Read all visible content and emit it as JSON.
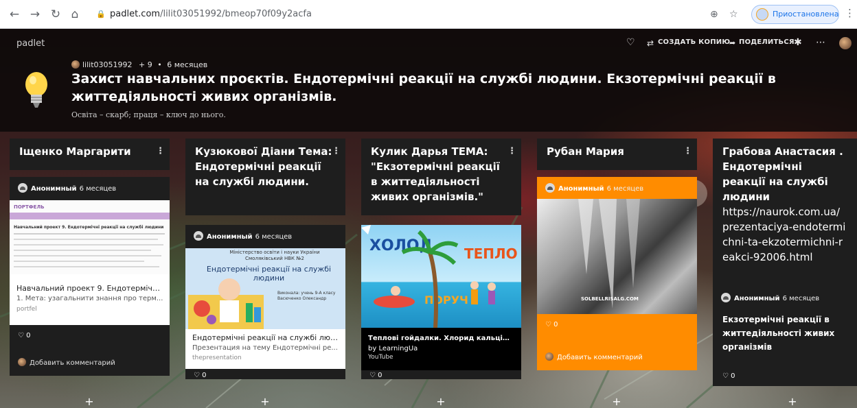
{
  "browser": {
    "url_host": "padlet.com",
    "url_path": "/lilit03051992/bmeop70f09y2acfa",
    "profile_label": "Приостановлена"
  },
  "padlet": {
    "brand": "padlet",
    "actions": {
      "copy": "СОЗДАТЬ КОПИЮ",
      "share": "ПОДЕЛИТЬСЯ"
    },
    "owner": "lilit03051992",
    "plus_count": "+ 9",
    "age": "6 месяцев",
    "title": "Захист навчальних проєктів. Ендотермічні реакції на службі людини. Екзотермічні реакції в життедіяльності живих організмів.",
    "subtitle": "Освіта – скарб; праця – ключ до нього."
  },
  "columns": [
    {
      "title": "Іщенко Маргарити",
      "post": {
        "author": "Анонимный",
        "time": "6 месяцев",
        "attach_title": "Навчальний проект 9. Ендотермічні р...",
        "attach_desc": "1. Мета: узагальнити знання про терм...",
        "attach_source": "portfel",
        "preview_banner": "ПОРТФЕЛЬ",
        "preview_heading": "Навчальний проект 9. Ендотермічні реакції на службі людини",
        "likes": "0",
        "comment": "Добавить комментарий"
      }
    },
    {
      "title": "Кузюкової Діани Тема: Ендотермічні реакції на службі людини.",
      "post": {
        "author": "Анонимный",
        "time": "6 месяцев",
        "slide_ministry": "Міністерство освіти і науки України Смоляківський НВК №2",
        "slide_title": "Ендотермічні реакції на службі людини",
        "slide_author": "Виконала: учень 9-А класу Васюченко Олександр",
        "attach_title": "Ендотермічні реакції на службі людин...",
        "attach_desc": "Презентация на тему Ендотермічні ре...",
        "attach_source": "thepresentation",
        "likes": "0"
      }
    },
    {
      "title": "Кулик Дарья ТЕМА: \"Екзотермічні реакції в життедіяльності живих організмів.\"",
      "post": {
        "thumb_cold": "ХОЛОД",
        "thumb_warm": "ТЕПЛО",
        "thumb_near": "ПОРУЧ",
        "attach_title": "Теплові гойдалки. Хлорид кальцію з в...",
        "attach_desc": "by LearningUa",
        "attach_source": "YouTube",
        "likes": "0"
      }
    },
    {
      "title": "Рубан Мария",
      "post": {
        "author": "Анонимный",
        "time": "6 месяцев",
        "watermark": "SOLBELLRISALG.COM",
        "likes": "0",
        "comment": "Добавить комментарий",
        "accent": "#ff8c00"
      }
    },
    {
      "title": "Грабова Анастасия . Ендотермічні реакції на службі людини",
      "link": "https://naurok.com.ua/prezentaciya-endotermichni-ta-ekzotermichni-reakci-92006.html",
      "post": {
        "author": "Анонимный",
        "time": "6 месяцев",
        "text": "Екзотермічні реакції в життедіяльності живих організмів",
        "likes": "0"
      }
    }
  ]
}
